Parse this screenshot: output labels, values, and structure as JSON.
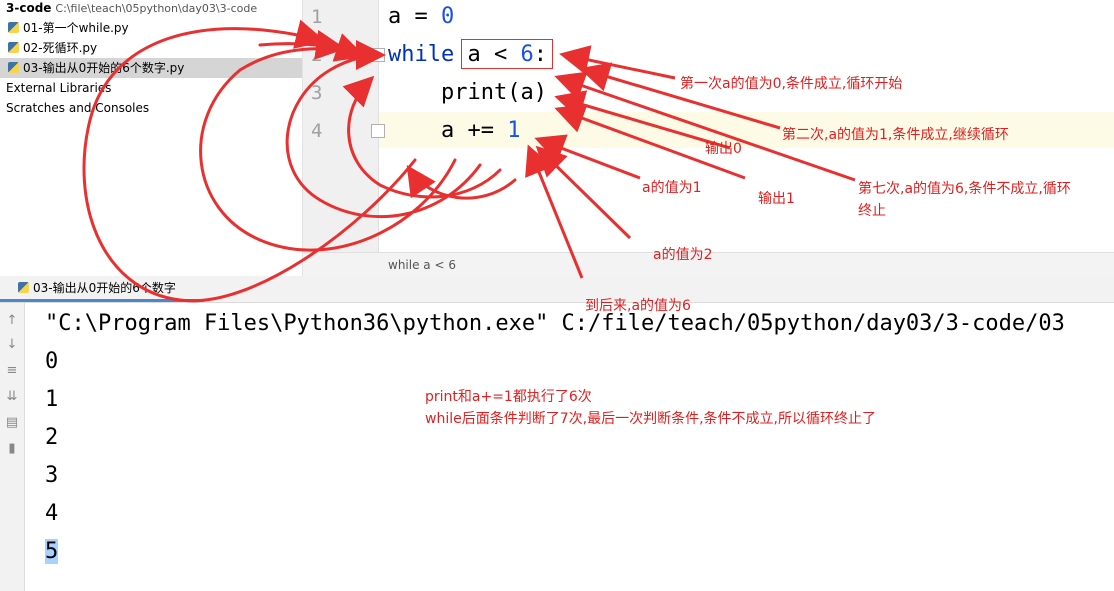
{
  "project": {
    "root_name": "3-code",
    "root_path": "C:\\file\\teach\\05python\\day03\\3-code",
    "files": [
      "01-第一个while.py",
      "02-死循环.py",
      "03-输出从0开始的6个数字.py"
    ],
    "external": "External Libraries",
    "scratches": "Scratches and Consoles"
  },
  "editor": {
    "line_numbers": [
      "1",
      "2",
      "3",
      "4"
    ],
    "line1": {
      "var": "a",
      "op": " = ",
      "num": "0"
    },
    "line2": {
      "kw": "while",
      "rest": " a < ",
      "num": "6",
      "colon": ":"
    },
    "line3": "    print(a)",
    "line4": {
      "pre": "    a += ",
      "num": "1"
    },
    "breadcrumb": "while a < 6"
  },
  "run": {
    "tab_label": "03-输出从0开始的6个数字",
    "command": "\"C:\\Program Files\\Python36\\python.exe\" C:/file/teach/05python/day03/3-code/03",
    "outputs": [
      "0",
      "1",
      "2",
      "3",
      "4",
      "5"
    ]
  },
  "annotations": {
    "n1": "第一次a的值为0,条件成立,循环开始",
    "n2": "第二次,a的值为1,条件成立,继续循环",
    "n3": "输出0",
    "n4": "a的值为1",
    "n5": "输出1",
    "n6a": "第七次,a的值为6,条件不成立,循环",
    "n6b": "终止",
    "n7": "a的值为2",
    "n8": "到后来,a的值为6",
    "summary1": "print和a+=1都执行了6次",
    "summary2": "while后面条件判断了7次,最后一次判断条件,条件不成立,所以循环终止了"
  },
  "colors": {
    "annotation": "#e02020",
    "keyword": "#0033b3",
    "number": "#1750eb",
    "selection": "#a6d2ff"
  }
}
